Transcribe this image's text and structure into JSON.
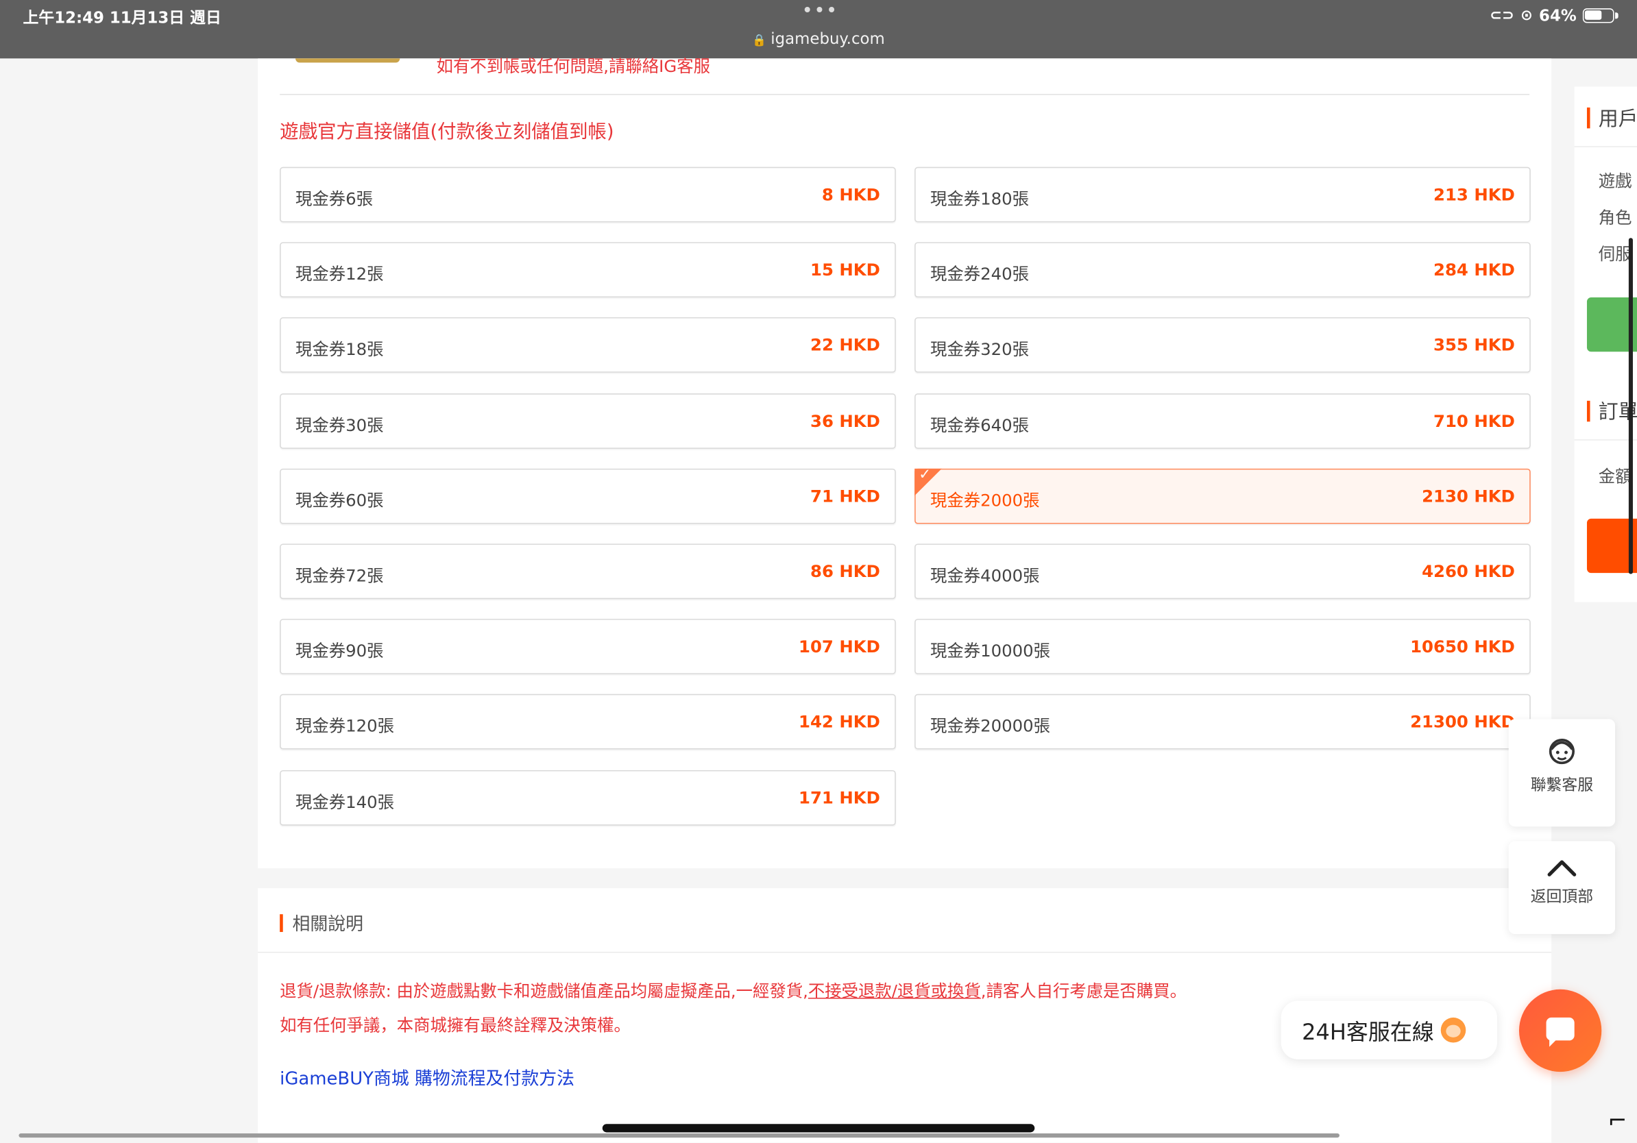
{
  "status_bar": {
    "time": "上午12:49  11月13日 週日",
    "url": "igamebuy.com",
    "battery": "64%",
    "battery_level": 0.64
  },
  "top_notice": "如有不到帳或任何問題,請聯絡IG客服",
  "section_title": "遊戲官方直接儲值(付款後立刻儲值到帳)",
  "products_left": [
    {
      "name": "現金券6張",
      "price": "8 HKD"
    },
    {
      "name": "現金券12張",
      "price": "15 HKD"
    },
    {
      "name": "現金券18張",
      "price": "22 HKD"
    },
    {
      "name": "現金券30張",
      "price": "36 HKD"
    },
    {
      "name": "現金券60張",
      "price": "71 HKD"
    },
    {
      "name": "現金券72張",
      "price": "86 HKD"
    },
    {
      "name": "現金券90張",
      "price": "107 HKD"
    },
    {
      "name": "現金券120張",
      "price": "142 HKD"
    },
    {
      "name": "現金券140張",
      "price": "171 HKD"
    }
  ],
  "products_right": [
    {
      "name": "現金券180張",
      "price": "213 HKD"
    },
    {
      "name": "現金券240張",
      "price": "284 HKD"
    },
    {
      "name": "現金券320張",
      "price": "355 HKD"
    },
    {
      "name": "現金券640張",
      "price": "710 HKD"
    },
    {
      "name": "現金券2000張",
      "price": "2130 HKD",
      "selected": true
    },
    {
      "name": "現金券4000張",
      "price": "4260 HKD"
    },
    {
      "name": "現金券10000張",
      "price": "10650 HKD"
    },
    {
      "name": "現金券20000張",
      "price": "21300 HKD"
    }
  ],
  "related": {
    "title": "相關說明",
    "refund_prefix": "退貨/退款條款: 由於遊戲點數卡和遊戲儲值產品均屬虛擬產品,一經發貨,",
    "refund_underline": "不接受退款/退貨或換貨",
    "refund_suffix": ",請客人自行考慮是否購買。",
    "dispute": "如有任何爭議，本商城擁有最終詮釋及決策權。",
    "link": "iGameBUY商城 購物流程及付款方法"
  },
  "right_panel": {
    "title1": "用戶",
    "label1": "遊戲",
    "label2": "角色",
    "label3": "伺服",
    "title2": "訂單",
    "label4": "金額"
  },
  "floating": {
    "contact": "聯繫客服",
    "back_top": "返回頂部",
    "chat_pill": "24H客服在線"
  },
  "colors": {
    "accent": "#ff4d00",
    "notice_red": "#e8373a",
    "link_blue": "#1a3fd6",
    "green": "#5cb85c"
  }
}
